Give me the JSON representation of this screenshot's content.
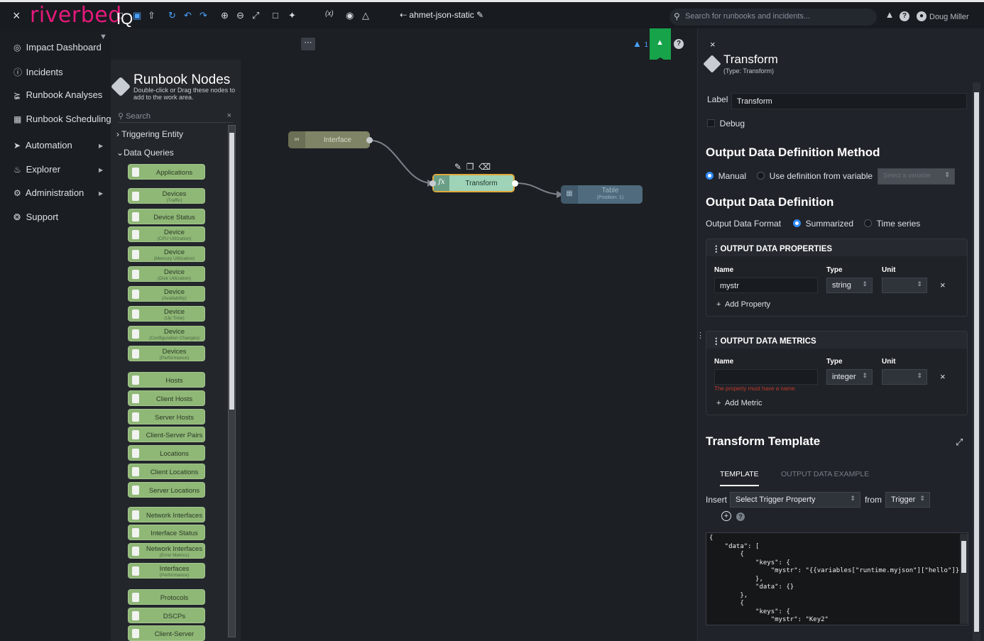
{
  "topbar": {
    "close": "×",
    "brand": "riverbed",
    "product": "IQ",
    "search_placeholder": "Search for runbooks and incidents...",
    "user": "Doug Miller"
  },
  "nav": {
    "items": [
      {
        "label": "Impact Dashboard",
        "icon": "globe-icon"
      },
      {
        "label": "Incidents",
        "icon": "alert-circle-icon"
      },
      {
        "label": "Runbook Analyses",
        "icon": "share-icon"
      },
      {
        "label": "Runbook Scheduling",
        "icon": "calendar-icon"
      },
      {
        "label": "Automation",
        "icon": "automation-icon"
      },
      {
        "label": "Explorer",
        "icon": "explorer-icon"
      },
      {
        "label": "Administration",
        "icon": "gear-icon"
      },
      {
        "label": "Support",
        "icon": "lifebuoy-icon"
      }
    ]
  },
  "palette": {
    "title": "Runbook Nodes",
    "subtitle": "Double-click or Drag these nodes to add to the work area.",
    "search_placeholder": "Search",
    "triggering": "Triggering Entity",
    "data_queries": "Data Queries",
    "nodes": [
      {
        "label": "Applications",
        "sub": ""
      },
      {
        "label": "Devices",
        "sub": "(Traffic)"
      },
      {
        "label": "Device Status",
        "sub": ""
      },
      {
        "label": "Device",
        "sub": "(CPU Utilization)"
      },
      {
        "label": "Device",
        "sub": "(Memory Utilization)"
      },
      {
        "label": "Device",
        "sub": "(Disk Utilization)"
      },
      {
        "label": "Device",
        "sub": "(Availability)"
      },
      {
        "label": "Device",
        "sub": "(Up Time)"
      },
      {
        "label": "Device",
        "sub": "(Configuration Changes)"
      },
      {
        "label": "Devices",
        "sub": "(Performance)"
      },
      {
        "label": "Hosts",
        "sub": ""
      },
      {
        "label": "Client Hosts",
        "sub": ""
      },
      {
        "label": "Server Hosts",
        "sub": ""
      },
      {
        "label": "Client-Server Pairs",
        "sub": ""
      },
      {
        "label": "Locations",
        "sub": ""
      },
      {
        "label": "Client Locations",
        "sub": ""
      },
      {
        "label": "Server Locations",
        "sub": ""
      },
      {
        "label": "Network Interfaces",
        "sub": ""
      },
      {
        "label": "Interface Status",
        "sub": ""
      },
      {
        "label": "Network Interfaces",
        "sub": "(Error Metrics)"
      },
      {
        "label": "Interfaces",
        "sub": "(Performance)"
      },
      {
        "label": "Protocols",
        "sub": ""
      },
      {
        "label": "DSCPs",
        "sub": ""
      },
      {
        "label": "Client-Server",
        "sub": ""
      }
    ]
  },
  "toolbar": {
    "runbook_name": "ahmet-json-static",
    "warnings": "1"
  },
  "canvas": {
    "interface": "Interface",
    "transform": "Transform",
    "table": "Table",
    "table_sub": "(Position: 1)"
  },
  "panel": {
    "title": "Transform",
    "subtitle": "(Type: Transform)",
    "label_label": "Label",
    "label_value": "Transform",
    "debug": "Debug",
    "odm_title": "Output Data Definition Method",
    "manual": "Manual",
    "use_var": "Use definition from variable",
    "var_placeholder": "Select a variable",
    "odd_title": "Output Data Definition",
    "odf_label": "Output Data Format",
    "summarized": "Summarized",
    "timeseries": "Time series",
    "props_title": "OUTPUT DATA PROPERTIES",
    "col_name": "Name",
    "col_type": "Type",
    "col_unit": "Unit",
    "prop_name": "mystr",
    "prop_type": "string",
    "add_property": "Add Property",
    "metrics_title": "OUTPUT DATA METRICS",
    "metric_type": "integer",
    "metric_error": "The property must have a name.",
    "add_metric": "Add Metric",
    "tt_title": "Transform Template",
    "tab_template": "TEMPLATE",
    "tab_example": "OUTPUT DATA EXAMPLE",
    "insert": "Insert",
    "insert_select": "Select Trigger Property",
    "from": "from",
    "from_select": "Trigger",
    "code": "{\n    \"data\": [\n        {\n            \"keys\": {\n                \"mystr\": \"{{variables[\"runtime.myjson\"][\"hello\"]}}\"\n            },\n            \"data\": {}\n        },\n        {\n            \"keys\": {\n                \"mystr\": \"Key2\"\n            }"
  }
}
